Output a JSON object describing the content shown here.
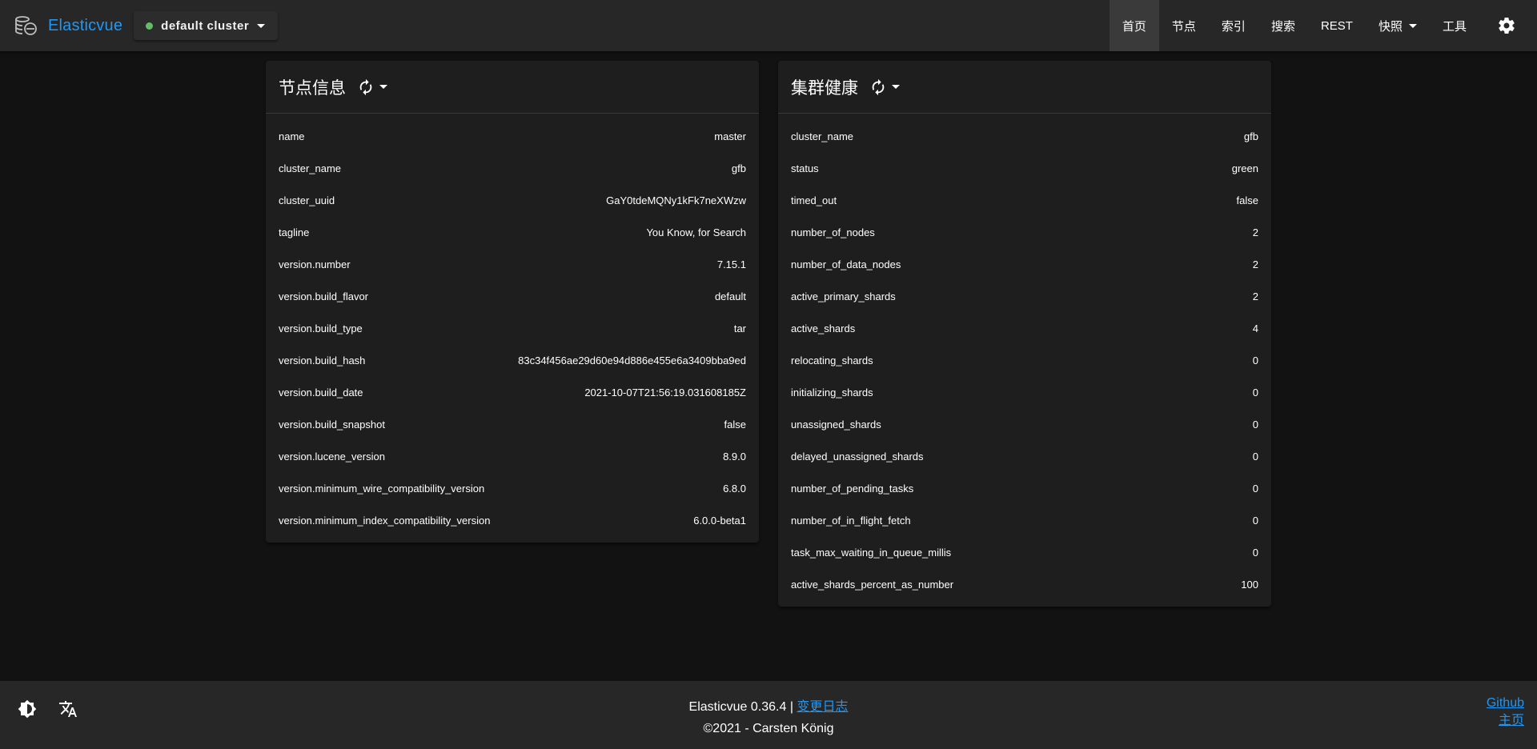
{
  "app": {
    "brand": "Elasticvue",
    "cluster": "default cluster",
    "cluster_status_color": "#66bb6a",
    "accent": "#2196f3"
  },
  "nav": {
    "items": [
      {
        "label": "首页",
        "active": true
      },
      {
        "label": "节点"
      },
      {
        "label": "索引"
      },
      {
        "label": "搜索"
      },
      {
        "label": "REST"
      },
      {
        "label": "快照",
        "dropdown": true
      },
      {
        "label": "工具"
      }
    ],
    "settings_icon": "gear-icon"
  },
  "node_info": {
    "title": "节点信息",
    "rows": [
      {
        "key": "name",
        "value": "master"
      },
      {
        "key": "cluster_name",
        "value": "gfb"
      },
      {
        "key": "cluster_uuid",
        "value": "GaY0tdeMQNy1kFk7neXWzw"
      },
      {
        "key": "tagline",
        "value": "You Know, for Search"
      },
      {
        "key": "version.number",
        "value": "7.15.1"
      },
      {
        "key": "version.build_flavor",
        "value": "default"
      },
      {
        "key": "version.build_type",
        "value": "tar"
      },
      {
        "key": "version.build_hash",
        "value": "83c34f456ae29d60e94d886e455e6a3409bba9ed"
      },
      {
        "key": "version.build_date",
        "value": "2021-10-07T21:56:19.031608185Z"
      },
      {
        "key": "version.build_snapshot",
        "value": "false"
      },
      {
        "key": "version.lucene_version",
        "value": "8.9.0"
      },
      {
        "key": "version.minimum_wire_compatibility_version",
        "value": "6.8.0"
      },
      {
        "key": "version.minimum_index_compatibility_version",
        "value": "6.0.0-beta1"
      }
    ]
  },
  "cluster_health": {
    "title": "集群健康",
    "rows": [
      {
        "key": "cluster_name",
        "value": "gfb"
      },
      {
        "key": "status",
        "value": "green"
      },
      {
        "key": "timed_out",
        "value": "false"
      },
      {
        "key": "number_of_nodes",
        "value": "2"
      },
      {
        "key": "number_of_data_nodes",
        "value": "2"
      },
      {
        "key": "active_primary_shards",
        "value": "2"
      },
      {
        "key": "active_shards",
        "value": "4"
      },
      {
        "key": "relocating_shards",
        "value": "0"
      },
      {
        "key": "initializing_shards",
        "value": "0"
      },
      {
        "key": "unassigned_shards",
        "value": "0"
      },
      {
        "key": "delayed_unassigned_shards",
        "value": "0"
      },
      {
        "key": "number_of_pending_tasks",
        "value": "0"
      },
      {
        "key": "number_of_in_flight_fetch",
        "value": "0"
      },
      {
        "key": "task_max_waiting_in_queue_millis",
        "value": "0"
      },
      {
        "key": "active_shards_percent_as_number",
        "value": "100"
      }
    ]
  },
  "footer": {
    "version_text": "Elasticvue 0.36.4 |",
    "changelog_label": "变更日志",
    "copyright": "©2021 - Carsten König",
    "github_label": "Github",
    "homepage_label": "主页"
  }
}
